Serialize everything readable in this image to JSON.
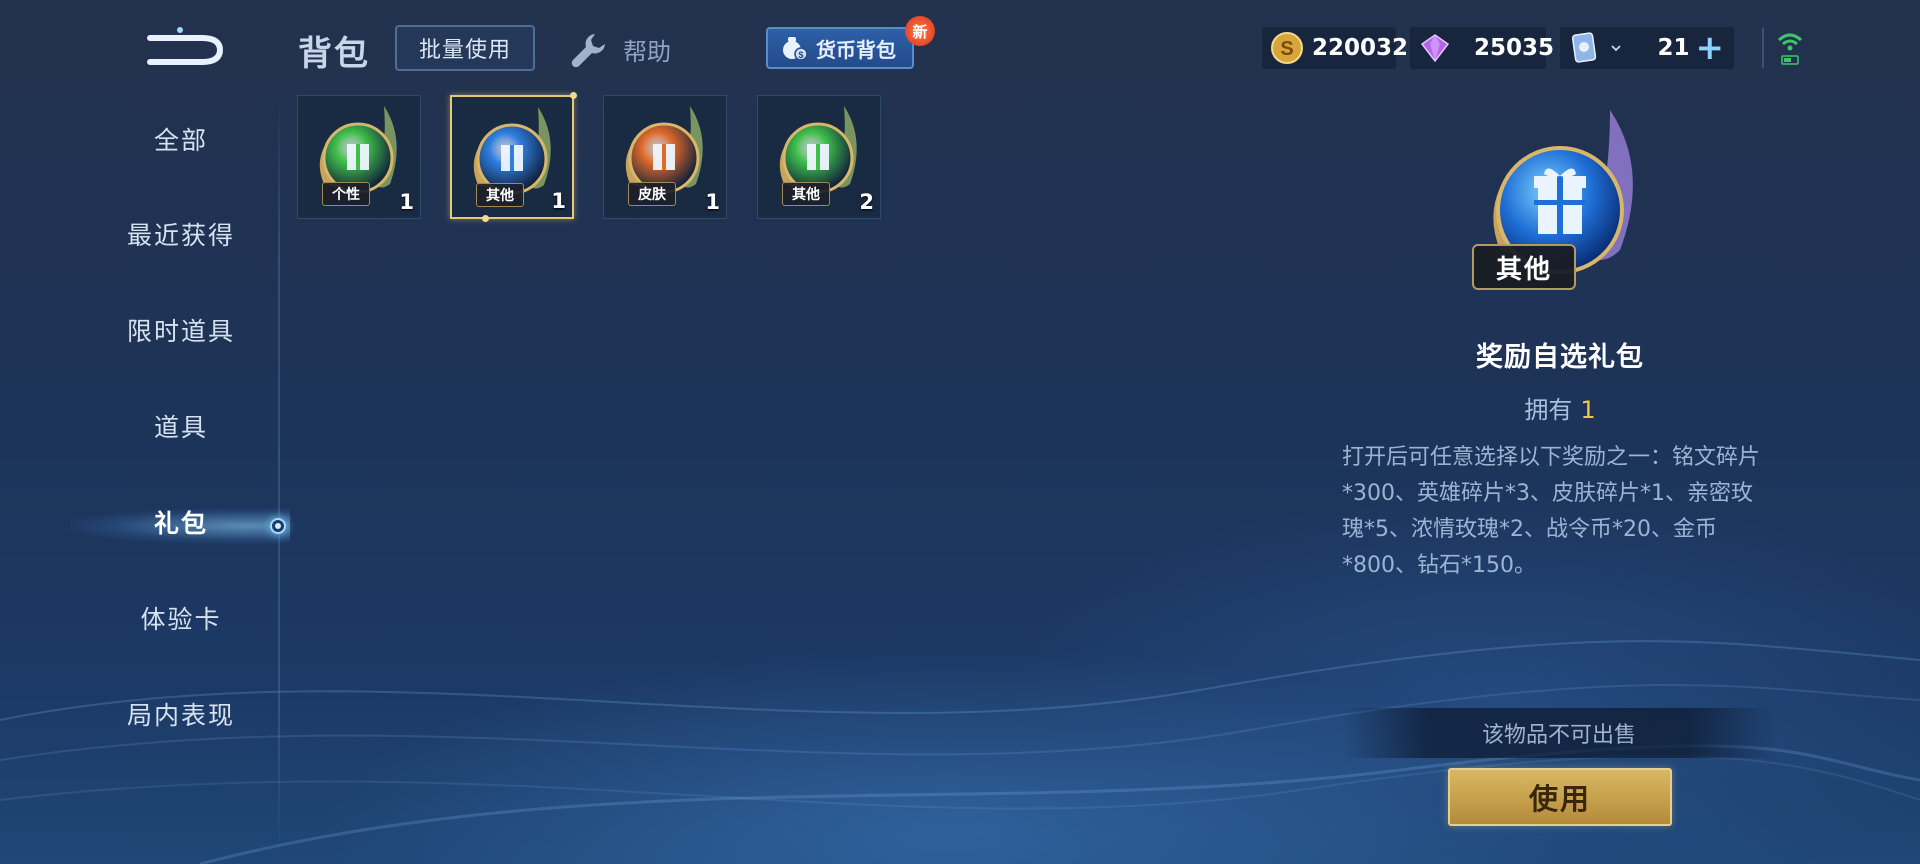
{
  "header": {
    "title": "背包",
    "batch_use": "批量使用",
    "help": "帮助",
    "currency_bag": "货币背包",
    "new_badge": "新"
  },
  "resources": {
    "gold": "220032",
    "diamond": "25035",
    "voucher": "21"
  },
  "sidebar": {
    "items": [
      {
        "label": "全部"
      },
      {
        "label": "最近获得"
      },
      {
        "label": "限时道具"
      },
      {
        "label": "道具"
      },
      {
        "label": "礼包"
      },
      {
        "label": "体验卡"
      },
      {
        "label": "局内表现"
      }
    ],
    "active_index": 4
  },
  "inventory": [
    {
      "tag": "个性",
      "count": "1",
      "color": "#3fbf4a"
    },
    {
      "tag": "其他",
      "count": "1",
      "color": "#2f7fe0",
      "selected": true
    },
    {
      "tag": "皮肤",
      "count": "1",
      "color": "#e06a2a"
    },
    {
      "tag": "其他",
      "count": "2",
      "color": "#3fbf4a"
    }
  ],
  "detail": {
    "tag": "其他",
    "name": "奖励自选礼包",
    "own_label": "拥有",
    "own_count": "1",
    "description": "打开后可任意选择以下奖励之一：铭文碎片*300、英雄碎片*3、皮肤碎片*1、亲密玫瑰*5、浓情玫瑰*2、战令币*20、金币*800、钻石*150。",
    "not_sellable": "该物品不可出售",
    "use_button": "使用"
  },
  "colors": {
    "accent_gold": "#e6cf8e",
    "own_count": "#f0c84a",
    "panel_border": "#304a6c"
  }
}
